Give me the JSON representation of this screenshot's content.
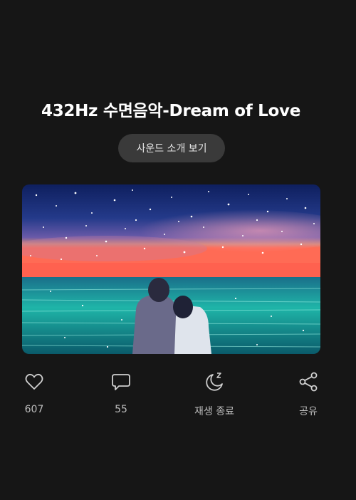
{
  "title": "432Hz 수면음악-Dream of Love",
  "intro_button": "사운드 소개 보기",
  "actions": {
    "like": {
      "icon": "heart-icon",
      "label": "607"
    },
    "comment": {
      "icon": "comment-icon",
      "label": "55"
    },
    "sleep_timer": {
      "icon": "moon-sleep-icon",
      "label": "재생 종료"
    },
    "share": {
      "icon": "share-icon",
      "label": "공유"
    }
  },
  "colors": {
    "background": "#161616",
    "button_bg": "#3a3a3a",
    "label": "#bdbdbd",
    "icon": "#d0d0d0"
  }
}
